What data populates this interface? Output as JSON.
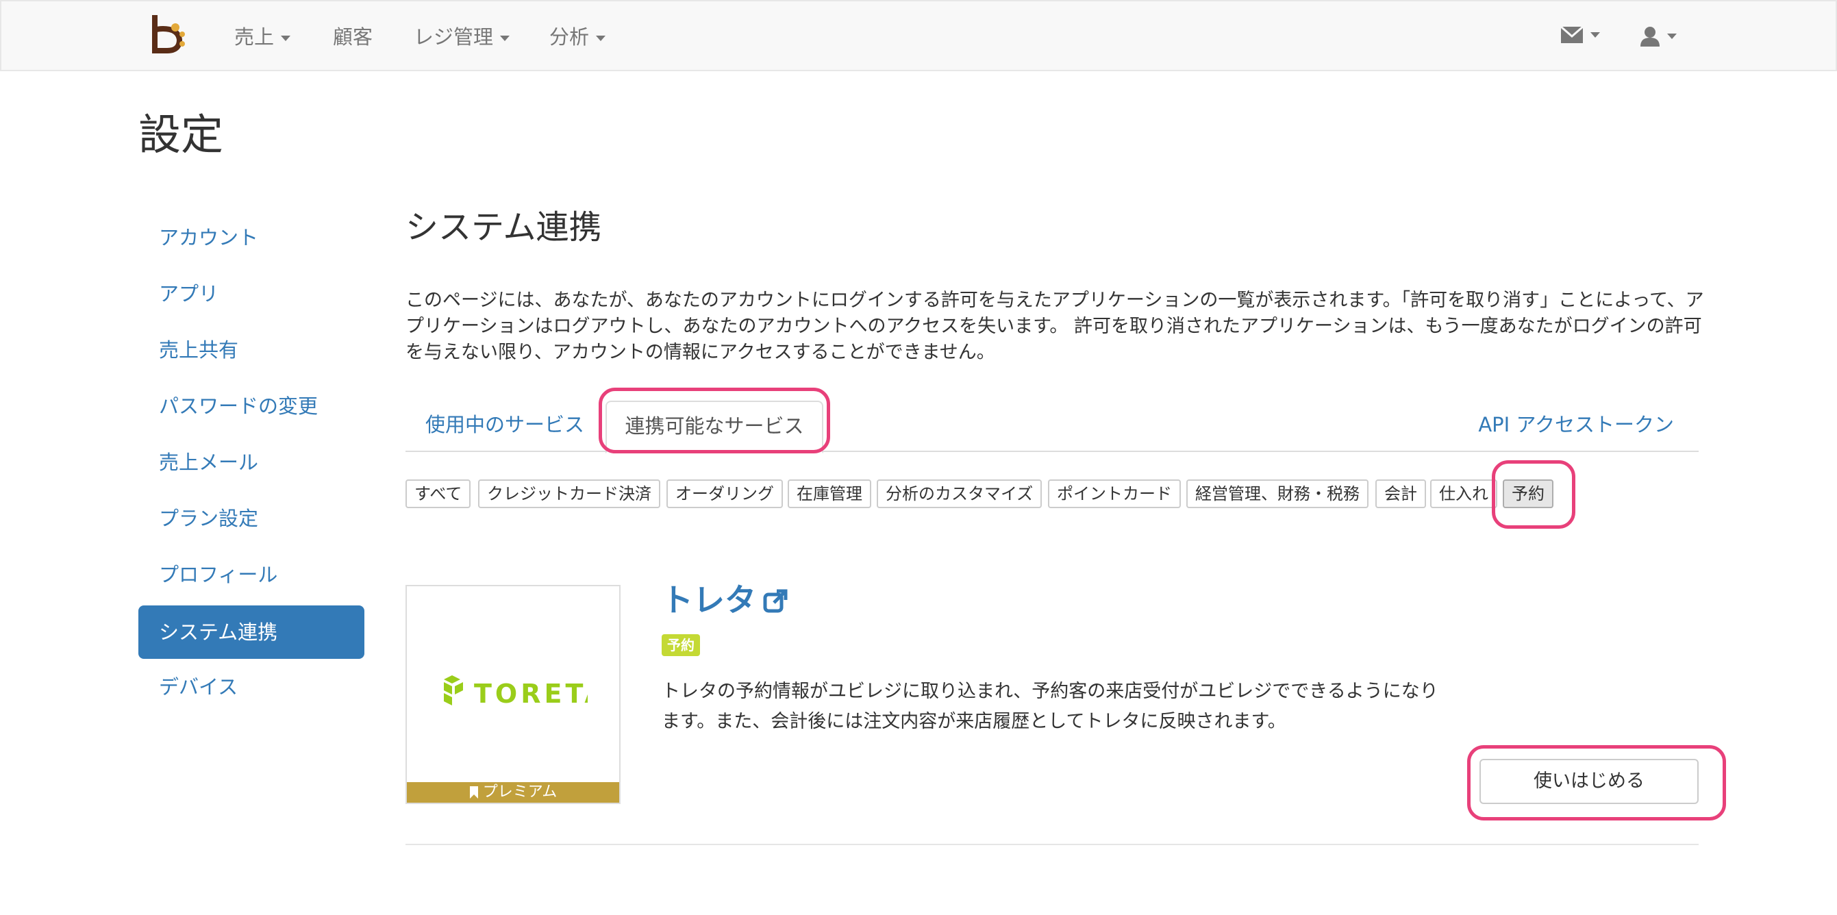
{
  "navbar": {
    "menu": [
      {
        "label": "売上",
        "dropdown": true
      },
      {
        "label": "顧客",
        "dropdown": false
      },
      {
        "label": "レジ管理",
        "dropdown": true
      },
      {
        "label": "分析",
        "dropdown": true
      }
    ],
    "icons": [
      "mail-icon",
      "user-icon"
    ]
  },
  "page": {
    "title": "設定"
  },
  "sidebar": {
    "items": [
      {
        "label": "アカウント",
        "active": false
      },
      {
        "label": "アプリ",
        "active": false
      },
      {
        "label": "売上共有",
        "active": false
      },
      {
        "label": "パスワードの変更",
        "active": false
      },
      {
        "label": "売上メール",
        "active": false
      },
      {
        "label": "プラン設定",
        "active": false
      },
      {
        "label": "プロフィール",
        "active": false
      },
      {
        "label": "システム連携",
        "active": true
      },
      {
        "label": "デバイス",
        "active": false
      }
    ]
  },
  "main": {
    "title": "システム連携",
    "description": "このページには、あなたが、あなたのアカウントにログインする許可を与えたアプリケーションの一覧が表示されます。「許可を取り消す」ことによって、アプリケーションはログアウトし、あなたのアカウントへのアクセスを失います。 許可を取り消されたアプリケーションは、もう一度あなたがログインの許可を与えない限り、アカウントの情報にアクセスすることができません。",
    "tabs": [
      {
        "label": "使用中のサービス",
        "active": false
      },
      {
        "label": "連携可能なサービス",
        "active": true
      }
    ],
    "api_link": "API アクセストークン",
    "filters": [
      {
        "label": "すべて",
        "active": false
      },
      {
        "label": "クレジットカード決済",
        "active": false
      },
      {
        "label": "オーダリング",
        "active": false
      },
      {
        "label": "在庫管理",
        "active": false
      },
      {
        "label": "分析のカスタマイズ",
        "active": false
      },
      {
        "label": "ポイントカード",
        "active": false
      },
      {
        "label": "経営管理、財務・税務",
        "active": false
      },
      {
        "label": "会計",
        "active": false
      },
      {
        "label": "仕入れ",
        "active": false
      },
      {
        "label": "予約",
        "active": true
      }
    ]
  },
  "service": {
    "name": "トレタ",
    "logo_text": "TORETA",
    "badge": "プレミアム",
    "category": "予約",
    "description": "トレタの予約情報がユビレジに取り込まれ、予約客の来店受付がユビレジでできるようになります。また、会計後には注文内容が来店履歴としてトレタに反映されます。",
    "button": "使いはじめる"
  },
  "colors": {
    "link": "#337ab7",
    "highlight": "#e8407a",
    "premium": "#c1a03c",
    "category_label": "#c4d934",
    "logo_green": "#9acd1a",
    "brand_brown": "#5a2d17"
  }
}
